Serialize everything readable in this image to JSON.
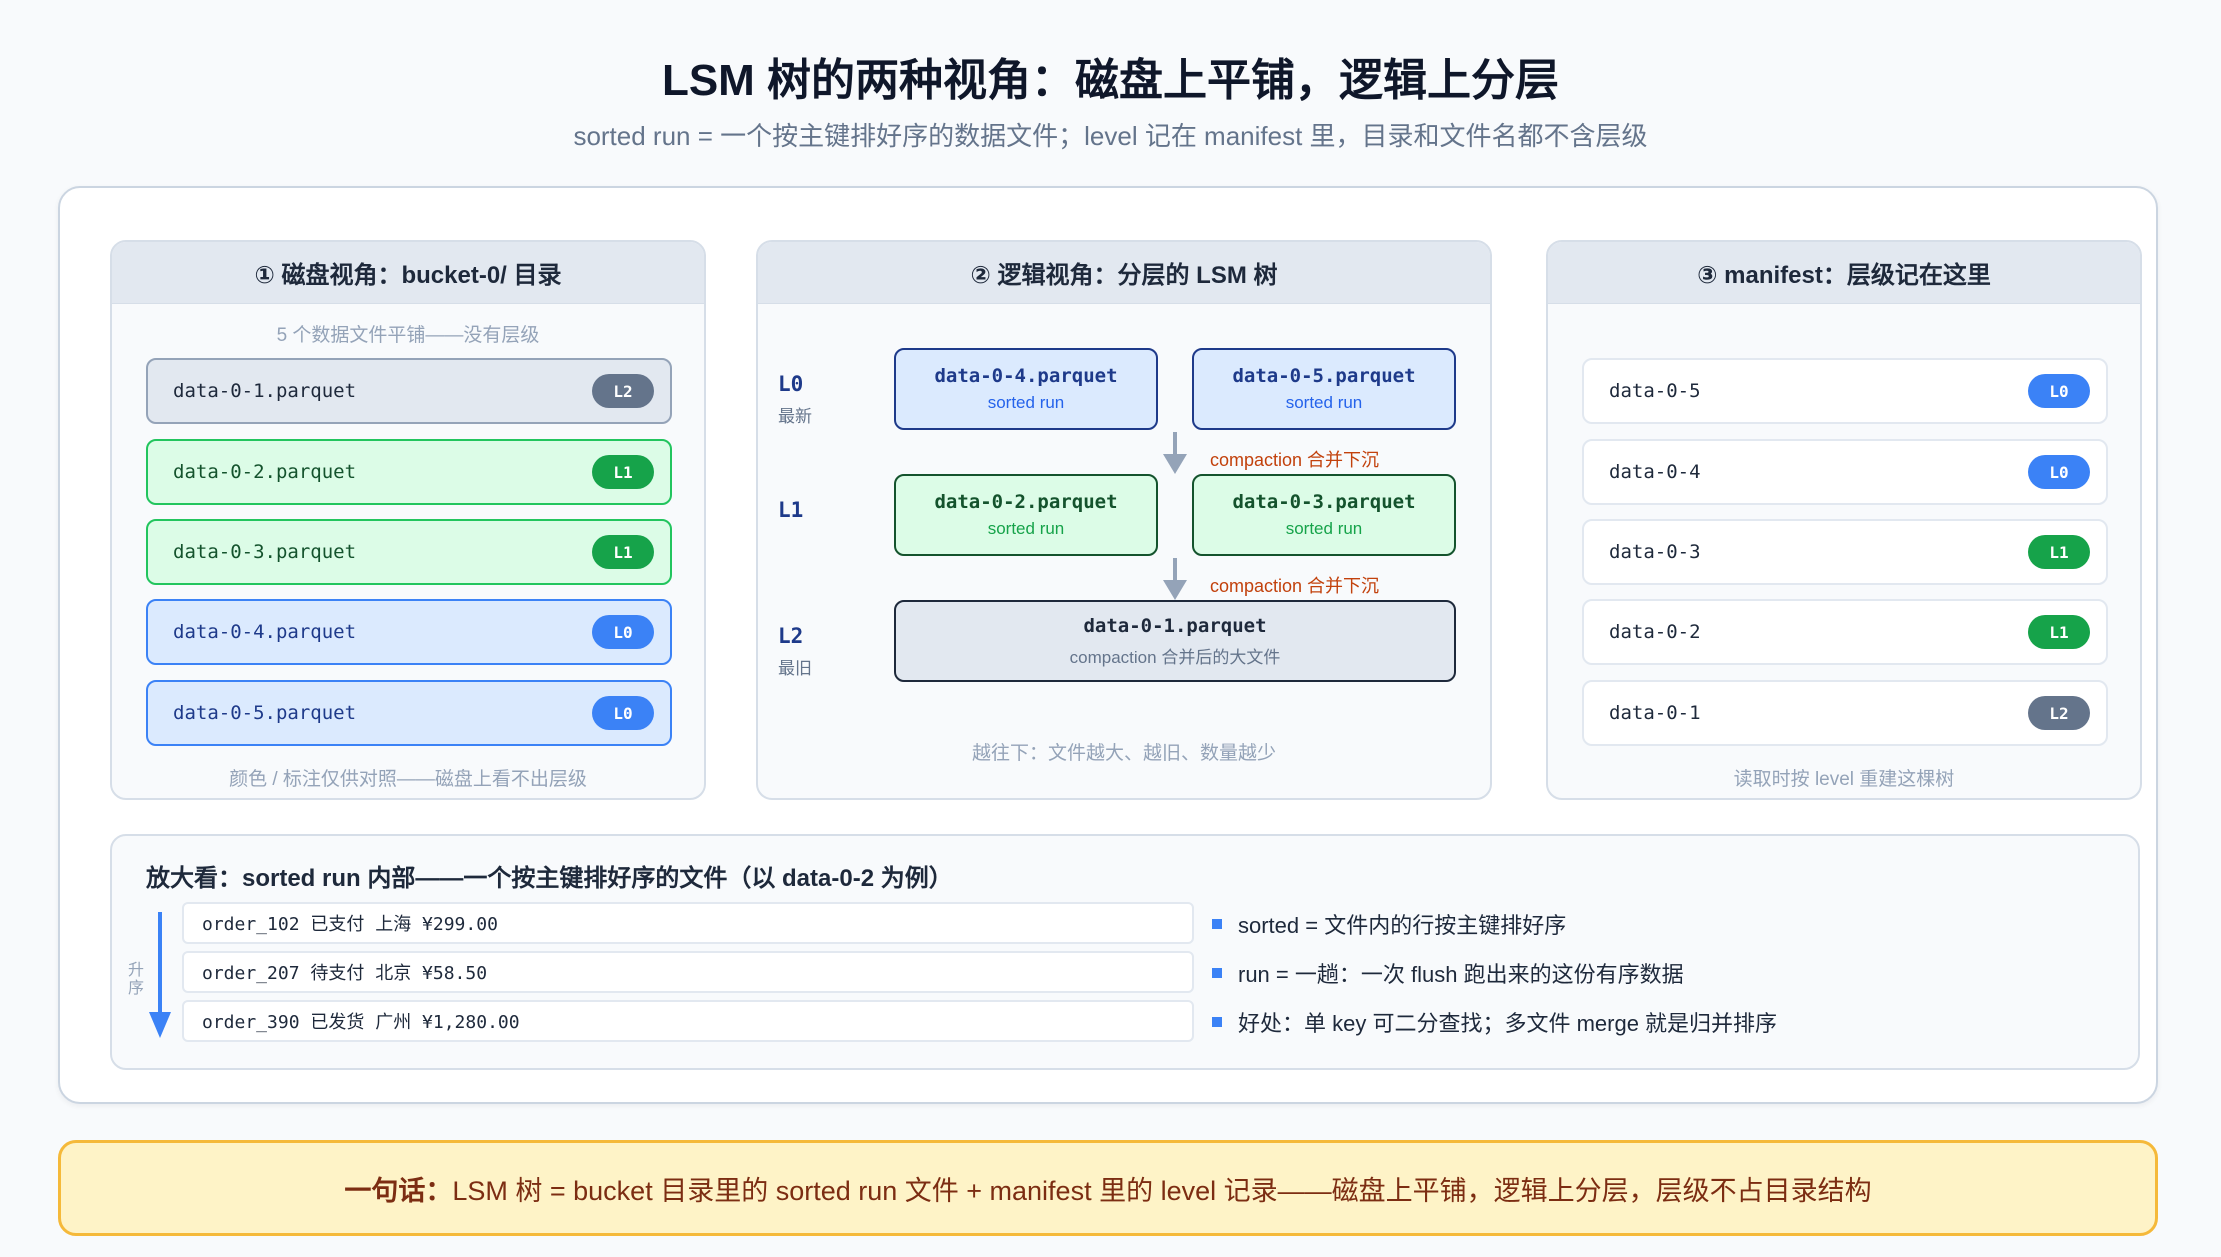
{
  "title": "LSM 树的两种视角：磁盘上平铺，逻辑上分层",
  "subtitle": "sorted run = 一个按主键排好序的数据文件；level 记在 manifest 里，目录和文件名都不含层级",
  "disk": {
    "header": "① 磁盘视角：bucket-0/ 目录",
    "top_note": "5 个数据文件平铺——没有层级",
    "files": [
      {
        "name": "data-0-1.parquet",
        "badge": "L2",
        "level": 2
      },
      {
        "name": "data-0-2.parquet",
        "badge": "L1",
        "level": 1
      },
      {
        "name": "data-0-3.parquet",
        "badge": "L1",
        "level": 1
      },
      {
        "name": "data-0-4.parquet",
        "badge": "L0",
        "level": 0
      },
      {
        "name": "data-0-5.parquet",
        "badge": "L0",
        "level": 0
      }
    ],
    "bottom_note": "颜色 / 标注仅供对照——磁盘上看不出层级"
  },
  "logical": {
    "header": "② 逻辑视角：分层的 LSM 树",
    "levels": [
      {
        "label": "L0",
        "sub": "最新"
      },
      {
        "label": "L1",
        "sub": ""
      },
      {
        "label": "L2",
        "sub": "最旧"
      }
    ],
    "l0": [
      {
        "name": "data-0-4.parquet",
        "sub": "sorted run"
      },
      {
        "name": "data-0-5.parquet",
        "sub": "sorted run"
      }
    ],
    "l1": [
      {
        "name": "data-0-2.parquet",
        "sub": "sorted run"
      },
      {
        "name": "data-0-3.parquet",
        "sub": "sorted run"
      }
    ],
    "l2": {
      "name": "data-0-1.parquet",
      "sub": "compaction 合并后的大文件"
    },
    "arrow_label_1": "compaction 合并下沉",
    "arrow_label_2": "compaction 合并下沉",
    "bottom_note": "越往下：文件越大、越旧、数量越少"
  },
  "manifest": {
    "header": "③ manifest：层级记在这里",
    "rows": [
      {
        "name": "data-0-5",
        "badge": "L0",
        "level": 0
      },
      {
        "name": "data-0-4",
        "badge": "L0",
        "level": 0
      },
      {
        "name": "data-0-3",
        "badge": "L1",
        "level": 1
      },
      {
        "name": "data-0-2",
        "badge": "L1",
        "level": 1
      },
      {
        "name": "data-0-1",
        "badge": "L2",
        "level": 2
      }
    ],
    "bottom_note": "读取时按 level 重建这棵树"
  },
  "zoom": {
    "title": "放大看：sorted run 内部——一个按主键排好序的文件（以 data-0-2 为例）",
    "asc_label": "升序",
    "rows": [
      "order_102  已支付  上海  ¥299.00",
      "order_207  待支付  北京  ¥58.50",
      "order_390  已发货  广州  ¥1,280.00"
    ],
    "bullets": [
      "sorted = 文件内的行按主键排好序",
      "run = 一趟：一次 flush 跑出来的这份有序数据",
      "好处：单 key 可二分查找；多文件 merge 就是归并排序"
    ]
  },
  "summary": {
    "lead": "一句话：",
    "text": "LSM 树 = bucket 目录里的 sorted run 文件 + manifest 里的 level 记录——磁盘上平铺，逻辑上分层，层级不占目录结构"
  },
  "colors": {
    "l0": "#3b82f6",
    "l1": "#16a34a",
    "l2": "#64748b",
    "arrow": "#94a3b8",
    "compaction_text": "#c2410c",
    "summary_bg": "#fef3c7"
  }
}
